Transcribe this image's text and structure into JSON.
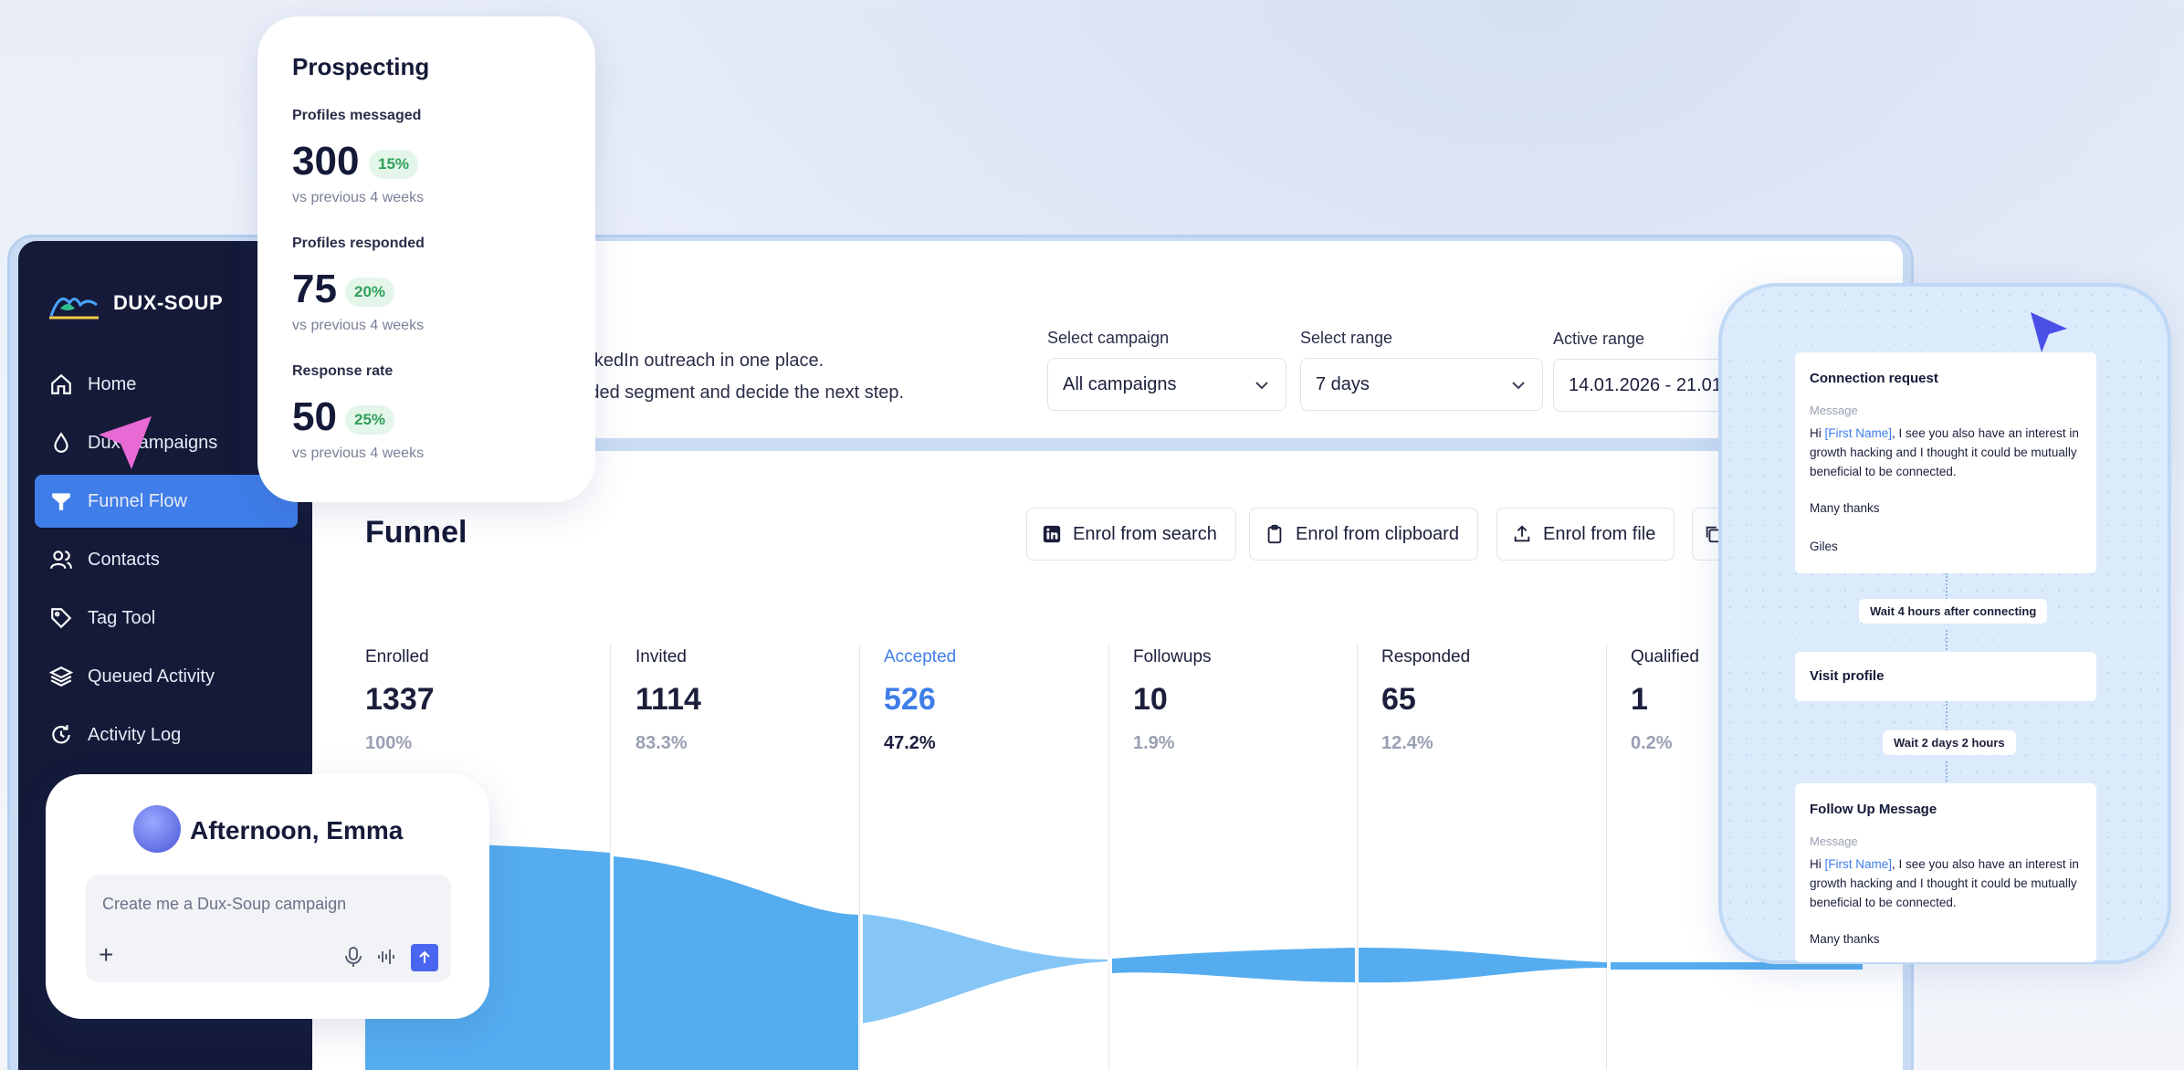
{
  "brand": {
    "name": "DUX-SOUP"
  },
  "sidebar": {
    "items": [
      {
        "label": "Home",
        "icon": "home-icon"
      },
      {
        "label": "Dux Campaigns",
        "icon": "droplet-icon"
      },
      {
        "label": "Funnel Flow",
        "icon": "funnel-icon",
        "active": true
      },
      {
        "label": "Contacts",
        "icon": "users-icon"
      },
      {
        "label": "Tag Tool",
        "icon": "tag-icon"
      },
      {
        "label": "Queued Activity",
        "icon": "layers-icon"
      },
      {
        "label": "Activity Log",
        "icon": "activity-log-icon"
      }
    ]
  },
  "prospecting": {
    "title": "Prospecting",
    "metrics": [
      {
        "label": "Profiles messaged",
        "value": "300",
        "badge": "15%",
        "sub": "vs previous 4 weeks"
      },
      {
        "label": "Profiles responded",
        "value": "75",
        "badge": "20%",
        "sub": "vs previous 4 weeks"
      },
      {
        "label": "Response rate",
        "value": "50",
        "badge": "25%",
        "sub": "vs previous 4 weeks"
      }
    ]
  },
  "header": {
    "intro_line1": "r LinkedIn outreach in one place.",
    "intro_line2": "ponded segment and decide the next step.",
    "campaign_label": "Select campaign",
    "campaign_value": "All campaigns",
    "range_label": "Select range",
    "range_value": "7 days",
    "active_label": "Active range",
    "active_value": "14.01.2026 - 21.01"
  },
  "funnel": {
    "title": "Funnel",
    "buttons": [
      "Enrol from search",
      "Enrol from clipboard",
      "Enrol from file"
    ],
    "stages": [
      {
        "name": "Enrolled",
        "value": "1337",
        "pct": "100%"
      },
      {
        "name": "Invited",
        "value": "1114",
        "pct": "83.3%"
      },
      {
        "name": "Accepted",
        "value": "526",
        "pct": "47.2%"
      },
      {
        "name": "Followups",
        "value": "10",
        "pct": "1.9%"
      },
      {
        "name": "Responded",
        "value": "65",
        "pct": "12.4%"
      },
      {
        "name": "Qualified",
        "value": "1",
        "pct": "0.2%"
      }
    ],
    "colors": {
      "primary": "#55adf0",
      "highlight": "#86c6f7"
    }
  },
  "chat": {
    "greeting": "Afternoon, Emma",
    "placeholder": "Create me a Dux-Soup campaign"
  },
  "sequence": {
    "connection": {
      "title": "Connection request",
      "meta": "Message",
      "pre": "Hi ",
      "token": "[First Name]",
      "post": ", I see you also have an interest in growth hacking and I thought it could be mutually beneficial to be connected.",
      "thanks": "Many thanks",
      "sign": "Giles"
    },
    "wait1": "Wait 4 hours after connecting",
    "visit": "Visit profile",
    "wait2": "Wait 2 days 2 hours",
    "followup": {
      "title": "Follow Up Message",
      "meta": "Message",
      "pre": "Hi ",
      "token": "[First Name]",
      "post": ", I see you also have an interest in growth hacking and I thought it could be mutually beneficial to be connected.",
      "thanks": "Many thanks"
    }
  }
}
